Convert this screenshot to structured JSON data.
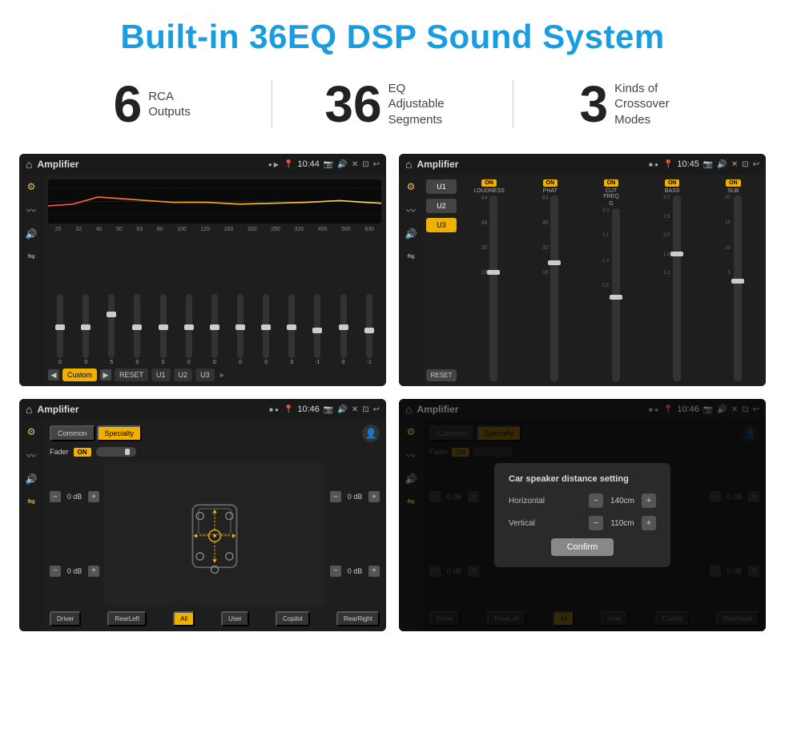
{
  "page": {
    "title": "Built-in 36EQ DSP Sound System",
    "stats": [
      {
        "number": "6",
        "label": "RCA\nOutputs"
      },
      {
        "number": "36",
        "label": "EQ Adjustable\nSegments"
      },
      {
        "number": "3",
        "label": "Kinds of\nCrossover Modes"
      }
    ]
  },
  "screen1": {
    "header": {
      "title": "Amplifier",
      "time": "10:44"
    },
    "eq": {
      "freqs": [
        "25",
        "32",
        "40",
        "50",
        "63",
        "80",
        "100",
        "125",
        "160",
        "200",
        "250",
        "320",
        "400",
        "500",
        "630"
      ],
      "values": [
        0,
        0,
        5,
        0,
        0,
        0,
        0,
        0,
        0,
        0,
        -1,
        0,
        -1
      ],
      "footer_buttons": [
        "Custom",
        "RESET",
        "U1",
        "U2",
        "U3"
      ]
    }
  },
  "screen2": {
    "header": {
      "title": "Amplifier",
      "time": "10:45"
    },
    "bands": [
      "LOUDNESS",
      "PHAT",
      "CUT FREQ",
      "BASS",
      "SUB"
    ],
    "u_buttons": [
      "U1",
      "U2",
      "U3"
    ],
    "active_u": "U3",
    "reset": "RESET"
  },
  "screen3": {
    "header": {
      "title": "Amplifier",
      "time": "10:46"
    },
    "tabs": [
      "Common",
      "Specialty"
    ],
    "active_tab": "Specialty",
    "fader_label": "Fader",
    "fader_on": "ON",
    "speaker_values": [
      "0 dB",
      "0 dB",
      "0 dB",
      "0 dB"
    ],
    "bottom_buttons": [
      "Driver",
      "RearLeft",
      "All",
      "User",
      "Copilot",
      "RearRight"
    ]
  },
  "screen4": {
    "header": {
      "title": "Amplifier",
      "time": "10:46"
    },
    "dialog": {
      "title": "Car speaker distance setting",
      "rows": [
        {
          "label": "Horizontal",
          "value": "140cm"
        },
        {
          "label": "Vertical",
          "value": "110cm"
        }
      ],
      "confirm_label": "Confirm"
    },
    "speaker_values": [
      "0 dB",
      "0 dB"
    ],
    "bottom_buttons": [
      "Driver",
      "RearLeft",
      "All",
      "User",
      "Copilot",
      "RearRight"
    ]
  }
}
